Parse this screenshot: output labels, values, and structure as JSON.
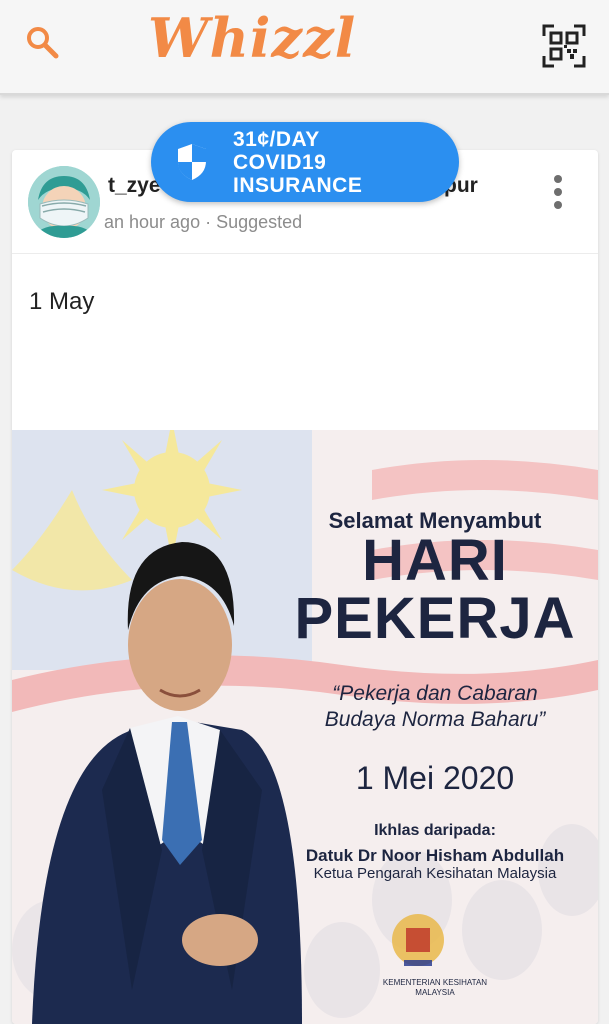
{
  "app": {
    "logo_text": "Whizzl",
    "accent_color": "#f28a46"
  },
  "toolbar": {
    "search_icon": "search-icon",
    "qr_icon": "qr-code-icon"
  },
  "promo": {
    "line1": "31¢/DAY",
    "line2": "COVID19",
    "line3": "INSURANCE",
    "icon": "shield-icon",
    "color": "#2b8ff0"
  },
  "post": {
    "username": "t_zye",
    "username_tail": "pur",
    "time": "an hour ago",
    "separator": " · ",
    "tag": "Suggested",
    "text": "1 May",
    "image": {
      "greeting": "Selamat Menyambut",
      "title_line1": "HARI",
      "title_line2": "PEKERJA",
      "quote_line1": "“Pekerja dan Cabaran",
      "quote_line2": "Budaya Norma Baharu”",
      "date": "1 Mei  2020",
      "from_label": "Ikhlas daripada:",
      "from_name": "Datuk Dr Noor Hisham Abdullah",
      "from_title": "Ketua Pengarah Kesihatan Malaysia",
      "ministry_line1": "KEMENTERIAN KESIHATAN",
      "ministry_line2": "MALAYSIA"
    }
  }
}
